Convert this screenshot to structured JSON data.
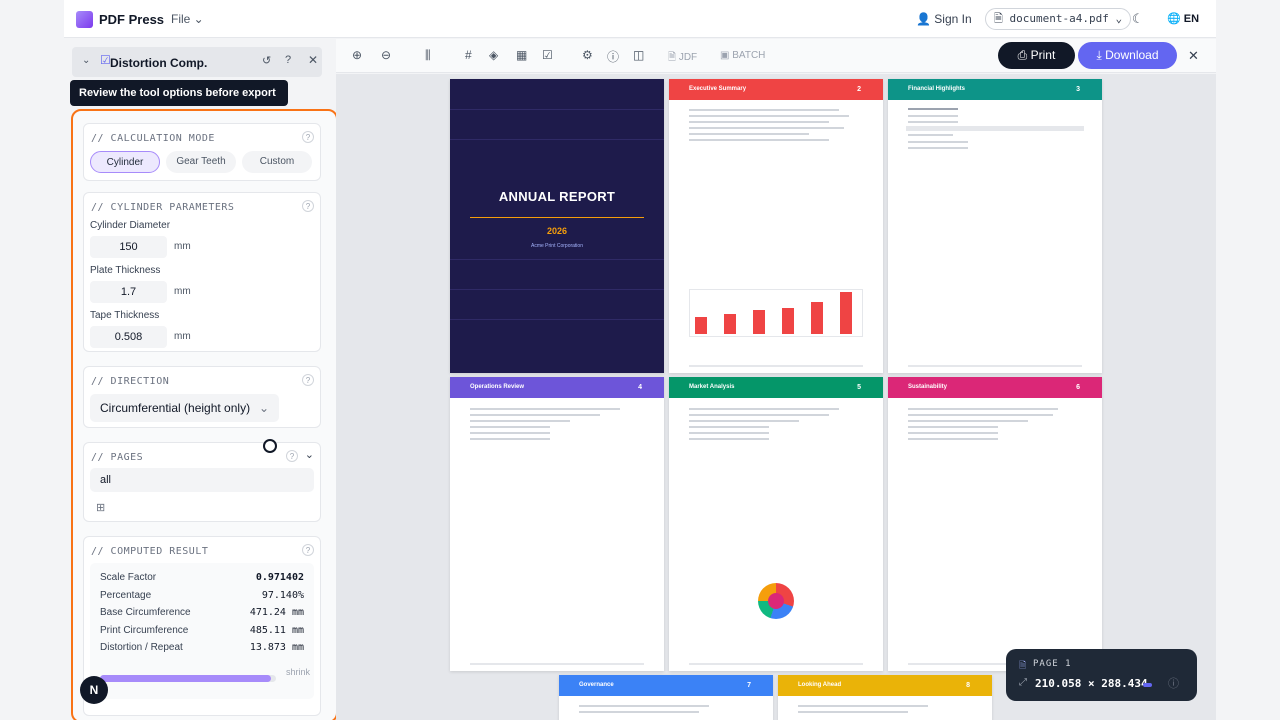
{
  "topbar": {
    "brand": "PDF Press",
    "file_menu": "File ⌄",
    "sign_in": "Sign In",
    "document": "document-a4.pdf",
    "lang": "EN"
  },
  "panel": {
    "title": "Distortion Comp.",
    "tooltip": "Review the tool options before export",
    "calc": {
      "title": "// CALCULATION MODE",
      "options": [
        "Cylinder",
        "Gear Teeth",
        "Custom"
      ],
      "selected": "Cylinder"
    },
    "cyl": {
      "title": "// CYLINDER PARAMETERS",
      "diameter_label": "Cylinder Diameter",
      "diameter": "150",
      "plate_label": "Plate Thickness",
      "plate": "1.7",
      "tape_label": "Tape Thickness",
      "tape": "0.508",
      "unit": "mm"
    },
    "direction": {
      "title": "// DIRECTION",
      "value": "Circumferential (height only)"
    },
    "pages": {
      "title": "// PAGES",
      "value": "all"
    },
    "result": {
      "title": "// COMPUTED RESULT",
      "rows": [
        {
          "label": "Scale Factor",
          "value": "0.971402"
        },
        {
          "label": "Percentage",
          "value": "97.140%"
        },
        {
          "label": "Base Circumference",
          "value": "471.24 mm"
        },
        {
          "label": "Print Circumference",
          "value": "485.11 mm"
        },
        {
          "label": "Distortion / Repeat",
          "value": "13.873 mm"
        }
      ],
      "bar_fraction": 0.97,
      "bar_label": "shrink"
    }
  },
  "toolbar": {
    "jdf": "JDF",
    "batch": "BATCH",
    "print": "Print",
    "download": "Download"
  },
  "pages": {
    "cover": {
      "title": "ANNUAL REPORT",
      "year": "2026",
      "org": "Acme Print Corporation"
    },
    "headers": [
      {
        "title": "Executive Summary",
        "num": "2",
        "color": "#ef4444"
      },
      {
        "title": "Financial Highlights",
        "num": "3",
        "color": "#0d9488"
      },
      {
        "title": "Operations Review",
        "num": "4",
        "color": "#6d55d9"
      },
      {
        "title": "Market Analysis",
        "num": "5",
        "color": "#059669"
      },
      {
        "title": "Sustainability",
        "num": "6",
        "color": "#db2777"
      },
      {
        "title": "Governance",
        "num": "7",
        "color": "#3b82f6"
      },
      {
        "title": "Looking Ahead",
        "num": "8",
        "color": "#eab308"
      }
    ]
  },
  "pagepill": {
    "label": "PAGE 1",
    "dims": "210.058 × 288.434"
  },
  "badge": "N"
}
